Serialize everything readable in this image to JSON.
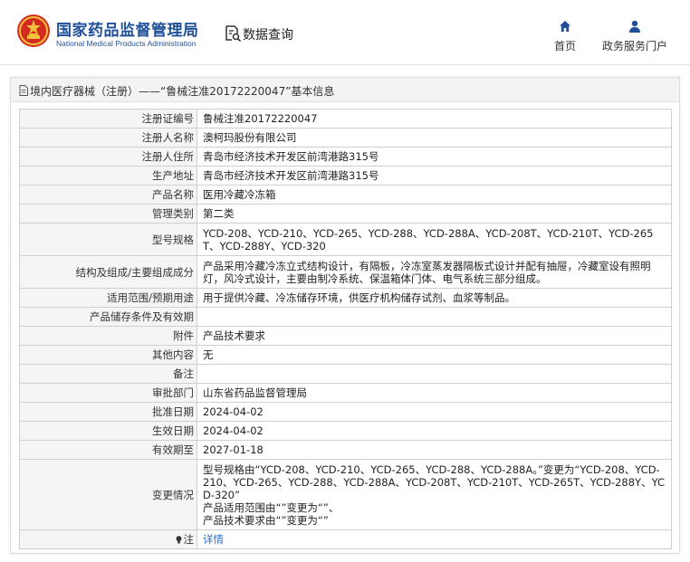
{
  "header": {
    "org_name_cn": "国家药品监督管理局",
    "org_name_en": "National Medical Products Administration",
    "query_label": "数据查询",
    "nav": {
      "home_label": "首页",
      "service_label": "政务服务门户"
    }
  },
  "panel": {
    "title": "境内医疗器械（注册）——“鲁械注准20172220047”基本信息"
  },
  "rows": [
    {
      "key": "注册证编号",
      "value": "鲁械注准20172220047"
    },
    {
      "key": "注册人名称",
      "value": "澳柯玛股份有限公司"
    },
    {
      "key": "注册人住所",
      "value": "青岛市经济技术开发区前湾港路315号"
    },
    {
      "key": "生产地址",
      "value": "青岛市经济技术开发区前湾港路315号"
    },
    {
      "key": "产品名称",
      "value": "医用冷藏冷冻箱"
    },
    {
      "key": "管理类别",
      "value": "第二类"
    },
    {
      "key": "型号规格",
      "value": "YCD-208、YCD-210、YCD-265、YCD-288、YCD-288A、YCD-208T、YCD-210T、YCD-265T、YCD-288Y、YCD-320"
    },
    {
      "key": "结构及组成/主要组成成分",
      "value": "产品采用冷藏冷冻立式结构设计，有隔板，冷冻室蒸发器隔板式设计并配有抽屉，冷藏室设有照明灯，风冷式设计，主要由制冷系统、保温箱体门体、电气系统三部分组成。"
    },
    {
      "key": "适用范围/预期用途",
      "value": "用于提供冷藏、冷冻储存环境，供医疗机构储存试剂、血浆等制品。"
    },
    {
      "key": "产品储存条件及有效期",
      "value": ""
    },
    {
      "key": "附件",
      "value": "产品技术要求"
    },
    {
      "key": "其他内容",
      "value": "无"
    },
    {
      "key": "备注",
      "value": ""
    },
    {
      "key": "审批部门",
      "value": "山东省药品监督管理局"
    },
    {
      "key": "批准日期",
      "value": "2024-04-02"
    },
    {
      "key": "生效日期",
      "value": "2024-04-02"
    },
    {
      "key": "有效期至",
      "value": "2027-01-18"
    },
    {
      "key": "变更情况",
      "value": "型号规格由“YCD-208、YCD-210、YCD-265、YCD-288、YCD-288A。”变更为“YCD-208、YCD-210、YCD-265、YCD-288、YCD-288A、YCD-208T、YCD-210T、YCD-265T、YCD-288Y、YCD-320”\n产品适用范围由“”变更为“”、\n产品技术要求由“”变更为“”"
    }
  ],
  "note": {
    "key": "注",
    "link_label": "详情"
  },
  "colors": {
    "brand_blue": "#1f4f97",
    "link_blue": "#2a6fc8",
    "emblem_red": "#d42a20",
    "emblem_gold": "#f2c23a"
  },
  "icons": {
    "logo": "national-emblem-icon",
    "query": "search-document-icon",
    "home": "home-icon",
    "service": "user-icon",
    "title": "document-icon",
    "note": "lightbulb-icon"
  }
}
